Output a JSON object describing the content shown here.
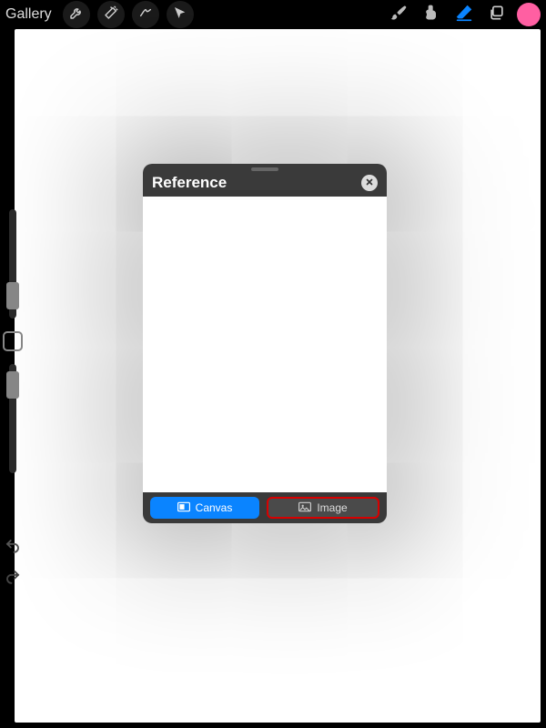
{
  "topbar": {
    "gallery_label": "Gallery"
  },
  "colors": {
    "swatch": "#ff5fa2",
    "eraser_active": "#0a84ff"
  },
  "reference": {
    "title": "Reference",
    "buttons": {
      "canvas": "Canvas",
      "image": "Image"
    },
    "active": "canvas",
    "highlighted": "image"
  }
}
